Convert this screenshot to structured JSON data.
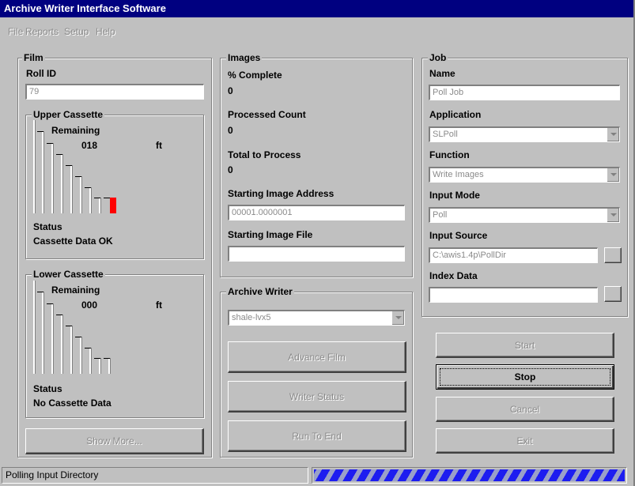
{
  "title": "Archive Writer Interface Software",
  "menu": [
    {
      "label": "File"
    },
    {
      "label": "Reports"
    },
    {
      "label": "Setup"
    },
    {
      "label": "Help"
    }
  ],
  "film": {
    "legend": "Film",
    "roll_id_label": "Roll ID",
    "roll_id_value": "79",
    "upper": {
      "legend": "Upper Cassette",
      "remaining_label": "Remaining",
      "remaining_value": "018",
      "unit": "ft",
      "status_label": "Status",
      "status_value": "Cassette Data OK",
      "level_color": "#ff0000"
    },
    "lower": {
      "legend": "Lower Cassette",
      "remaining_label": "Remaining",
      "remaining_value": "000",
      "unit": "ft",
      "status_label": "Status",
      "status_value": "No Cassette Data"
    },
    "show_more": "Show More..."
  },
  "images": {
    "legend": "Images",
    "pct_label": "% Complete",
    "pct_value": "0",
    "processed_label": "Processed Count",
    "processed_value": "0",
    "total_label": "Total to Process",
    "total_value": "0",
    "start_addr_label": "Starting Image Address",
    "start_addr_value": "00001.0000001",
    "start_file_label": "Starting Image File",
    "start_file_value": ""
  },
  "archive": {
    "legend": "Archive Writer",
    "writer_select": "shale-lvx5",
    "advance_film": "Advance Film",
    "writer_status": "Writer Status",
    "run_to_end": "Run To End"
  },
  "job": {
    "legend": "Job",
    "name_label": "Name",
    "name_value": "Poll Job",
    "application_label": "Application",
    "application_value": "SLPoll",
    "function_label": "Function",
    "function_value": "Write Images",
    "input_mode_label": "Input Mode",
    "input_mode_value": "Poll",
    "input_source_label": "Input Source",
    "input_source_value": "C:\\awis1.4p\\PollDir",
    "index_data_label": "Index Data",
    "index_data_value": ""
  },
  "buttons": {
    "start": "Start",
    "stop": "Stop",
    "cancel": "Cancel",
    "exit": "Exit"
  },
  "status": {
    "text": "Polling Input Directory",
    "progress_color": "#1d1df0"
  }
}
